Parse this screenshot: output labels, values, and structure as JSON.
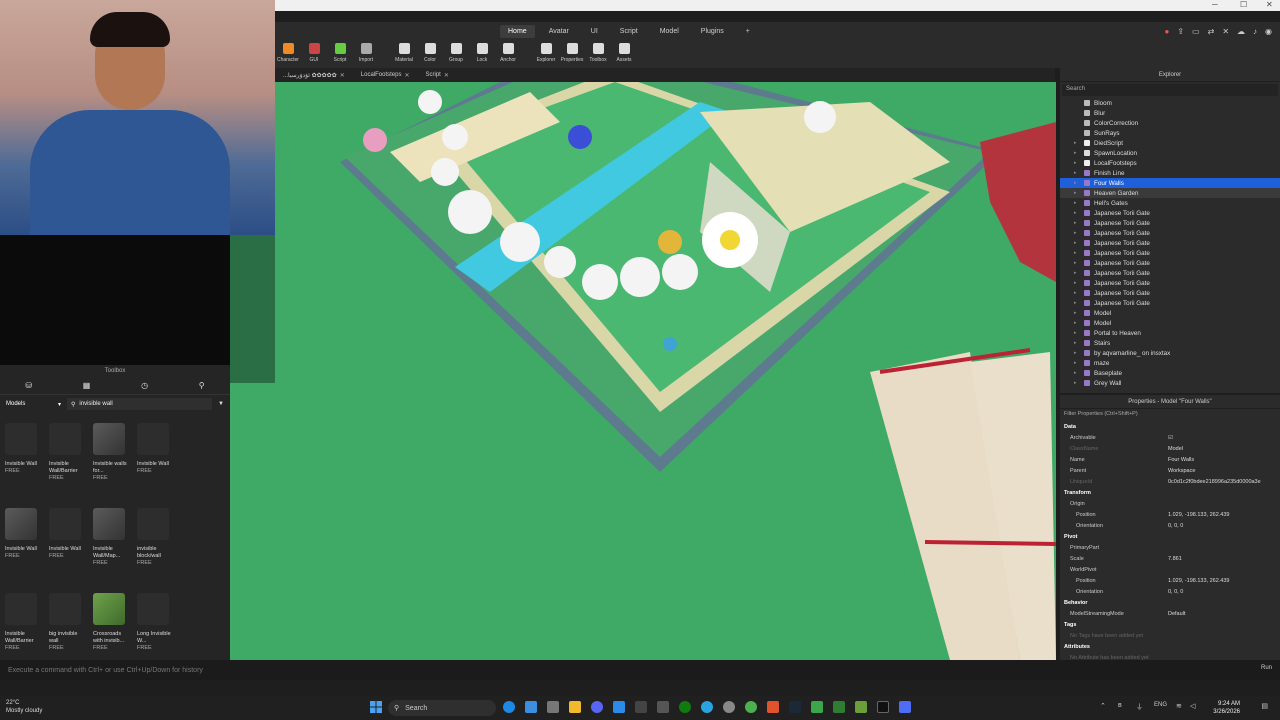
{
  "ribbon_tabs": [
    "Home",
    "Avatar",
    "UI",
    "Script",
    "Model",
    "Plugins",
    "+"
  ],
  "ribbon_tools": [
    "Character",
    "GUI",
    "Script",
    "Import",
    "Material",
    "Color",
    "Group",
    "Lock",
    "Anchor",
    "Explorer",
    "Properties",
    "Toolbox",
    "Assets"
  ],
  "doc_tabs": [
    {
      "label": "...ئۆدۆرسیا ✿✿✿✿✿"
    },
    {
      "label": "LocalFootsteps"
    },
    {
      "label": "Script"
    }
  ],
  "toolbox": {
    "title": "Toolbox",
    "category": "Models",
    "search_value": "invisible wall",
    "items": [
      {
        "name": "Invisible Wall",
        "badge": "FREE"
      },
      {
        "name": "Invisible Wall/Barrier",
        "badge": "FREE"
      },
      {
        "name": "Invisible walls for...",
        "badge": "FREE"
      },
      {
        "name": "Invisible Wall",
        "badge": "FREE"
      },
      {
        "name": "Invisible Wall",
        "badge": "FREE"
      },
      {
        "name": "Invisible Wall",
        "badge": "FREE"
      },
      {
        "name": "Invisible Wall/Map...",
        "badge": "FREE"
      },
      {
        "name": "invisible block/wall",
        "badge": "FREE"
      },
      {
        "name": "Invisible Wall/Barrier",
        "badge": "FREE"
      },
      {
        "name": "big invisible wall",
        "badge": "FREE"
      },
      {
        "name": "Crossroads with invisib...",
        "badge": "FREE"
      },
      {
        "name": "Long Invisible W...",
        "badge": "FREE"
      }
    ]
  },
  "explorer": {
    "title": "Explorer",
    "search_placeholder": "Search",
    "items": [
      {
        "label": "Bloom"
      },
      {
        "label": "Blur"
      },
      {
        "label": "ColorCorrection"
      },
      {
        "label": "SunRays"
      },
      {
        "label": "DiedScript"
      },
      {
        "label": "SpawnLocation"
      },
      {
        "label": "LocalFootsteps"
      },
      {
        "label": "Finish Line"
      },
      {
        "label": "Four Walls",
        "selected": true
      },
      {
        "label": "Heaven Garden"
      },
      {
        "label": "Hell's Gates"
      },
      {
        "label": "Japanese Torii Gate"
      },
      {
        "label": "Japanese Torii Gate"
      },
      {
        "label": "Japanese Torii Gate"
      },
      {
        "label": "Japanese Torii Gate"
      },
      {
        "label": "Japanese Torii Gate"
      },
      {
        "label": "Japanese Torii Gate"
      },
      {
        "label": "Japanese Torii Gate"
      },
      {
        "label": "Japanese Torii Gate"
      },
      {
        "label": "Japanese Torii Gate"
      },
      {
        "label": "Japanese Torii Gate"
      },
      {
        "label": "Model"
      },
      {
        "label": "Model"
      },
      {
        "label": "Portal to Heaven"
      },
      {
        "label": "Stairs"
      },
      {
        "label": "by aqvamarline_ on insxtax"
      },
      {
        "label": "maze"
      },
      {
        "label": "Baseplate"
      },
      {
        "label": "Grey Wall"
      }
    ]
  },
  "properties": {
    "title": "Properties - Model \"Four Walls\"",
    "filter": "Filter Properties (Ctrl+Shift+P)",
    "rows": [
      {
        "k": "Data",
        "v": "",
        "type": "sec"
      },
      {
        "k": "Archivable",
        "v": "☑",
        "type": "row"
      },
      {
        "k": "ClassName",
        "v": "Model",
        "type": "dim"
      },
      {
        "k": "Name",
        "v": "Four Walls",
        "type": "row"
      },
      {
        "k": "Parent",
        "v": "Workspace",
        "type": "row"
      },
      {
        "k": "UniqueId",
        "v": "0c0d1c2f0bdee218996a235d0000a3e",
        "type": "dim"
      },
      {
        "k": "Transform",
        "v": "",
        "type": "sec"
      },
      {
        "k": "Origin",
        "v": "",
        "type": "row"
      },
      {
        "k": "Position",
        "v": "1.029, -198.133, 262.439",
        "type": "sub"
      },
      {
        "k": "Orientation",
        "v": "0, 0, 0",
        "type": "sub"
      },
      {
        "k": "Pivot",
        "v": "",
        "type": "sec"
      },
      {
        "k": "PrimaryPart",
        "v": "",
        "type": "row"
      },
      {
        "k": "Scale",
        "v": "7.861",
        "type": "row"
      },
      {
        "k": "WorldPivot",
        "v": "",
        "type": "row"
      },
      {
        "k": "Position",
        "v": "1.029, -198.133, 262.439",
        "type": "sub"
      },
      {
        "k": "Orientation",
        "v": "0, 0, 0",
        "type": "sub"
      },
      {
        "k": "Behavior",
        "v": "",
        "type": "sec"
      },
      {
        "k": "ModelStreamingMode",
        "v": "Default",
        "type": "row"
      },
      {
        "k": "Tags",
        "v": "",
        "type": "sec"
      },
      {
        "k": "No Tags have been added yet",
        "v": "",
        "type": "dim"
      },
      {
        "k": "Attributes",
        "v": "",
        "type": "sec"
      },
      {
        "k": "No Attribute has been added yet",
        "v": "",
        "type": "dim"
      }
    ]
  },
  "command_bar": {
    "placeholder": "Execute a command with Ctrl+ or use Ctrl+Up/Down for history",
    "run": "Run"
  },
  "taskbar": {
    "weather_temp": "22°C",
    "weather_desc": "Mostly cloudy",
    "search": "Search",
    "lang": "ENG",
    "time": "9:24 AM",
    "date": "3/26/2026"
  },
  "colors": {
    "accent": "#1f5fd9",
    "grass": "#3eaa66",
    "water": "#40c9e0"
  }
}
